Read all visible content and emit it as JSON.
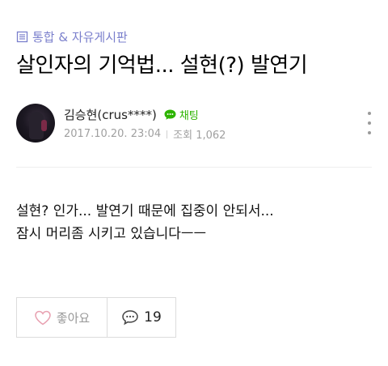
{
  "breadcrumb": {
    "icon": "board-list-icon",
    "text": "통합 & 자유게시판"
  },
  "post": {
    "title": "살인자의 기억법... 설현(?) 발연기",
    "body_lines": [
      "설현? 인가... 발연기 때문에 집중이 안되서...",
      "잠시 머리좀 시키고 있습니다ㅡㅡ"
    ]
  },
  "author": {
    "name": "김승현(crus****)",
    "chat_label": "채팅",
    "avatar": "user-avatar"
  },
  "meta": {
    "date": "2017.10.20. 23:04",
    "views": "조회 1,062"
  },
  "actions": {
    "like_label": "좋아요",
    "comment_count": "19"
  },
  "colors": {
    "breadcrumb": "#7a7fcc",
    "chat": "#2db400",
    "meta": "#a0a0a0",
    "border": "#dcdcdc"
  }
}
